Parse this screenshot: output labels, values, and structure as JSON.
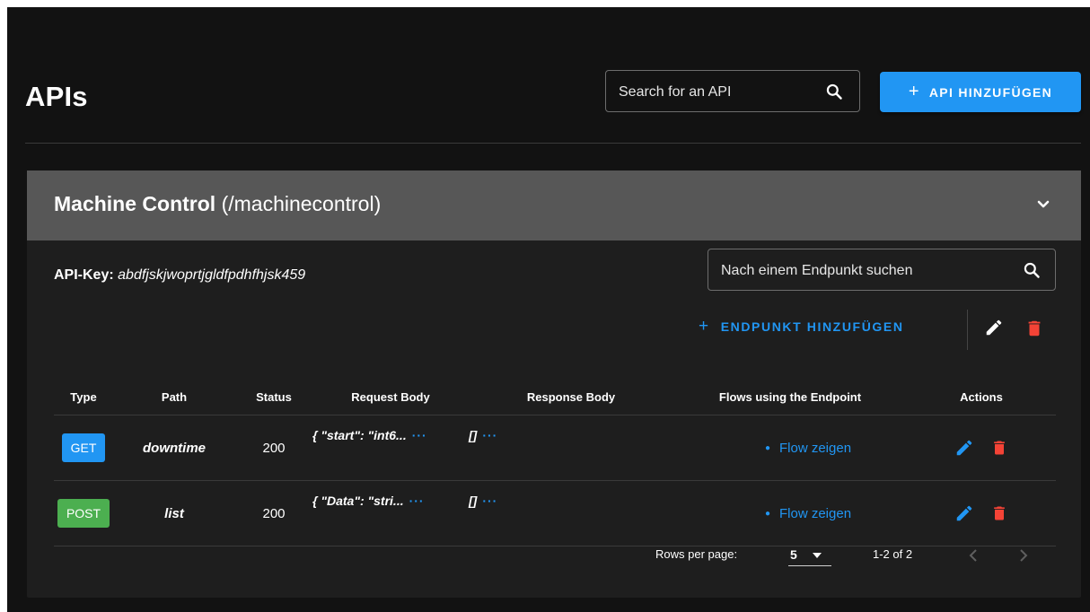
{
  "page": {
    "title": "APIs"
  },
  "search": {
    "placeholder": "Search for an API"
  },
  "add_api_button": {
    "label": "API HINZUFÜGEN"
  },
  "api_card": {
    "name": "Machine Control",
    "path": "(/machinecontrol)",
    "api_key_label": "API-Key:",
    "api_key_value": "abdfjskjwoprtjgldfpdhfhjsk459",
    "endpoint_search_placeholder": "Nach einem Endpunkt suchen",
    "add_endpoint_label": "ENDPUNKT HINZUFÜGEN",
    "table": {
      "headers": [
        "Type",
        "Path",
        "Status",
        "Request Body",
        "Response Body",
        "Flows using the Endpoint",
        "Actions"
      ],
      "rows": [
        {
          "method": "GET",
          "path": "downtime",
          "status": "200",
          "request_body": "{ \"start\": \"int6...",
          "response_body": "[]",
          "flow_link": "Flow zeigen"
        },
        {
          "method": "POST",
          "path": "list",
          "status": "200",
          "request_body": "{ \"Data\": \"stri...",
          "response_body": "[]",
          "flow_link": "Flow zeigen"
        }
      ]
    },
    "pagination": {
      "rows_per_page_label": "Rows per page:",
      "rows_per_page_value": "5",
      "range": "1-2 of 2"
    }
  },
  "colors": {
    "accent": "#2196f3",
    "get_badge": "#2196f3",
    "post_badge": "#4caf50",
    "delete": "#f44336",
    "card_header": "#575757",
    "background": "#121212"
  },
  "icons": {
    "search": "search-icon",
    "expand": "chevron-down-icon",
    "edit": "pencil-icon",
    "delete": "trash-icon",
    "more": "ellipsis-icon",
    "prev": "chevron-left-icon",
    "next": "chevron-right-icon",
    "dropdown": "caret-down-icon"
  }
}
